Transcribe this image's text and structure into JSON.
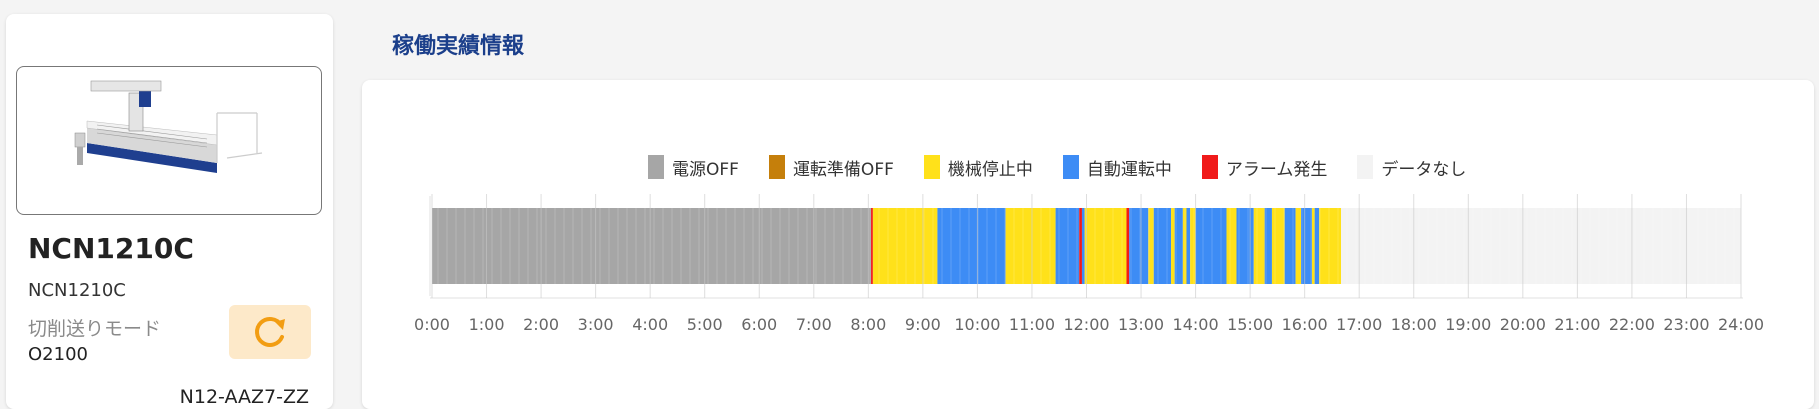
{
  "machine": {
    "name": "NCN1210C",
    "model": "NCN1210C",
    "mode_label": "切削送りモード",
    "program": "O2100",
    "serial": "N12-AAZ7-ZZ",
    "image_icon": "cnc-machine-image",
    "refresh_icon": "refresh-icon",
    "refresh_color": "#f29d12"
  },
  "section_title": "稼働実績情報",
  "chart_data": {
    "type": "timeline",
    "legend": [
      {
        "key": "off",
        "label": "電源OFF",
        "color": "#a6a6a6"
      },
      {
        "key": "prep_off",
        "label": "運転準備OFF",
        "color": "#c57f0b"
      },
      {
        "key": "stop",
        "label": "機械停止中",
        "color": "#ffe11a"
      },
      {
        "key": "auto",
        "label": "自動運転中",
        "color": "#3d8cf5"
      },
      {
        "key": "alarm",
        "label": "アラーム発生",
        "color": "#f01a1a"
      },
      {
        "key": "none",
        "label": "データなし",
        "color": "#f3f3f3"
      }
    ],
    "x_range": [
      "0:00",
      "24:00"
    ],
    "ticks": [
      "0:00",
      "1:00",
      "2:00",
      "3:00",
      "4:00",
      "5:00",
      "6:00",
      "7:00",
      "8:00",
      "9:00",
      "10:00",
      "11:00",
      "12:00",
      "13:00",
      "14:00",
      "15:00",
      "16:00",
      "17:00",
      "18:00",
      "19:00",
      "20:00",
      "21:00",
      "22:00",
      "23:00",
      "24:00"
    ],
    "segments": [
      {
        "start": "0:00",
        "end": "8:03",
        "state": "off"
      },
      {
        "start": "8:03",
        "end": "8:05",
        "state": "alarm"
      },
      {
        "start": "8:05",
        "end": "9:16",
        "state": "stop"
      },
      {
        "start": "9:16",
        "end": "10:31",
        "state": "auto"
      },
      {
        "start": "10:31",
        "end": "11:26",
        "state": "stop"
      },
      {
        "start": "11:26",
        "end": "11:52",
        "state": "auto"
      },
      {
        "start": "11:52",
        "end": "11:55",
        "state": "alarm"
      },
      {
        "start": "11:55",
        "end": "11:58",
        "state": "auto"
      },
      {
        "start": "11:58",
        "end": "12:44",
        "state": "stop"
      },
      {
        "start": "12:44",
        "end": "12:47",
        "state": "alarm"
      },
      {
        "start": "12:47",
        "end": "13:08",
        "state": "auto"
      },
      {
        "start": "13:08",
        "end": "13:14",
        "state": "stop"
      },
      {
        "start": "13:14",
        "end": "13:33",
        "state": "auto"
      },
      {
        "start": "13:33",
        "end": "13:37",
        "state": "stop"
      },
      {
        "start": "13:37",
        "end": "13:46",
        "state": "auto"
      },
      {
        "start": "13:46",
        "end": "13:50",
        "state": "stop"
      },
      {
        "start": "13:50",
        "end": "13:54",
        "state": "auto"
      },
      {
        "start": "13:54",
        "end": "14:00",
        "state": "stop"
      },
      {
        "start": "14:00",
        "end": "14:34",
        "state": "auto"
      },
      {
        "start": "14:34",
        "end": "14:45",
        "state": "stop"
      },
      {
        "start": "14:45",
        "end": "15:04",
        "state": "auto"
      },
      {
        "start": "15:04",
        "end": "15:16",
        "state": "stop"
      },
      {
        "start": "15:16",
        "end": "15:24",
        "state": "auto"
      },
      {
        "start": "15:24",
        "end": "15:38",
        "state": "stop"
      },
      {
        "start": "15:38",
        "end": "15:50",
        "state": "auto"
      },
      {
        "start": "15:50",
        "end": "15:56",
        "state": "stop"
      },
      {
        "start": "15:56",
        "end": "16:08",
        "state": "auto"
      },
      {
        "start": "16:08",
        "end": "16:11",
        "state": "stop"
      },
      {
        "start": "16:11",
        "end": "16:16",
        "state": "auto"
      },
      {
        "start": "16:16",
        "end": "16:40",
        "state": "stop"
      },
      {
        "start": "16:40",
        "end": "24:00",
        "state": "none"
      }
    ]
  }
}
